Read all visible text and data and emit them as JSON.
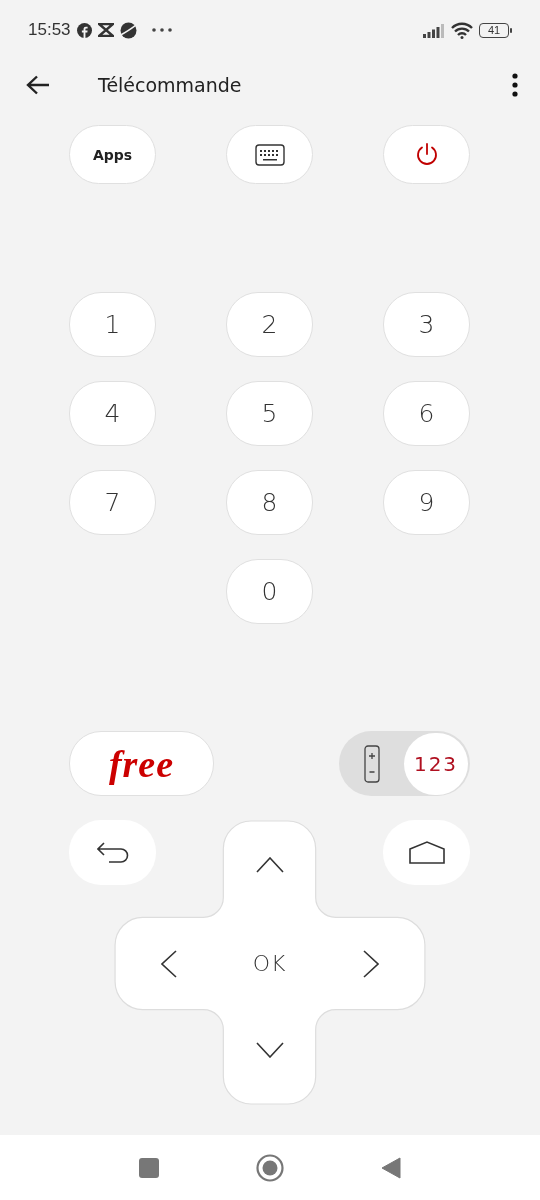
{
  "status_bar": {
    "time": "15:53",
    "battery": "41"
  },
  "app_bar": {
    "title": "Télécommande"
  },
  "top_buttons": [
    {
      "kind": "apps",
      "label": "Apps"
    },
    {
      "kind": "keyboard"
    },
    {
      "kind": "power"
    }
  ],
  "keypad": [
    "1",
    "2",
    "3",
    "4",
    "5",
    "6",
    "7",
    "8",
    "9",
    "0"
  ],
  "brand_button": {
    "label": "free"
  },
  "mode_toggle": {
    "options": [
      {
        "kind": "remote",
        "selected": false
      },
      {
        "kind": "numbers",
        "label": "123",
        "selected": true
      }
    ]
  },
  "dpad": {
    "center": "OK"
  }
}
